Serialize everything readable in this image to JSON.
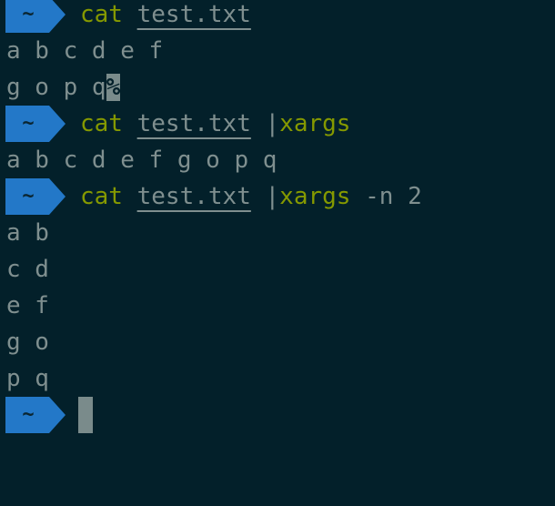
{
  "prompt_symbol": "~",
  "colors": {
    "background": "#03202a",
    "prompt": "#2378c8",
    "command": "#859900",
    "text": "#7f8f8f"
  },
  "commands": [
    {
      "cmd": "cat",
      "file": "test.txt",
      "pipe": "",
      "pipe_cmd": "",
      "args": ""
    },
    {
      "cmd": "cat",
      "file": "test.txt",
      "pipe": " |",
      "pipe_cmd": "xargs",
      "args": ""
    },
    {
      "cmd": "cat",
      "file": "test.txt",
      "pipe": " |",
      "pipe_cmd": "xargs",
      "args": " -n 2"
    }
  ],
  "outputs": {
    "cmd1": [
      "a b c d e f",
      "g o p q"
    ],
    "cmd1_eol_marker": "%",
    "cmd2": [
      "a b c d e f g o p q"
    ],
    "cmd3": [
      "a b",
      "c d",
      "e f",
      "g o",
      "p q"
    ]
  }
}
